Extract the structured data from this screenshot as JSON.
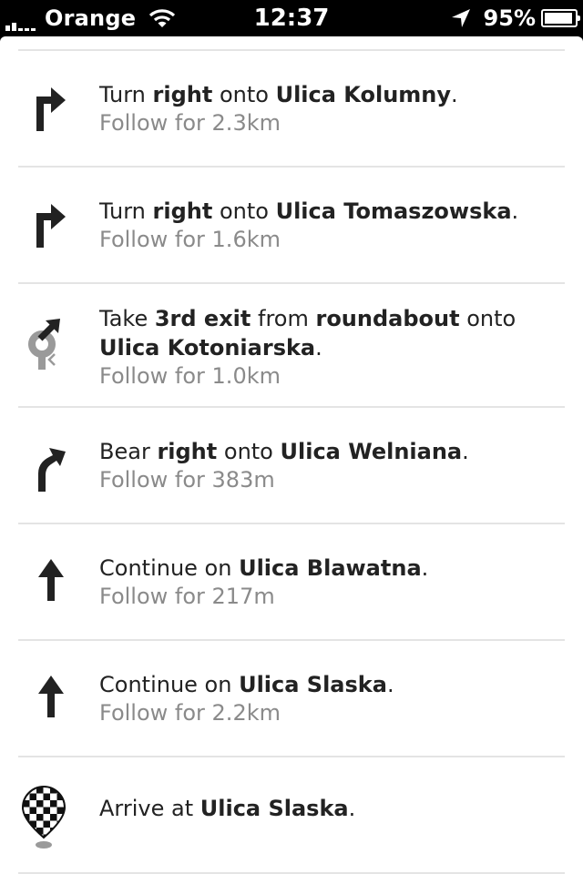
{
  "status_bar": {
    "carrier": "Orange",
    "time": "12:37",
    "battery_percent_text": "95%",
    "battery_level": 0.95,
    "icons": [
      "signal-bars",
      "wifi-icon",
      "location-arrow-icon",
      "battery-icon"
    ]
  },
  "steps": [
    {
      "icon": "turn-right-icon",
      "parts": [
        {
          "text": "Turn ",
          "bold": false
        },
        {
          "text": "right",
          "bold": true
        },
        {
          "text": " onto ",
          "bold": false
        },
        {
          "text": "Ulica Kolumny",
          "bold": true
        },
        {
          "text": ".",
          "bold": false
        }
      ],
      "follow": "Follow for 2.3km"
    },
    {
      "icon": "turn-right-icon",
      "parts": [
        {
          "text": "Turn ",
          "bold": false
        },
        {
          "text": "right",
          "bold": true
        },
        {
          "text": " onto ",
          "bold": false
        },
        {
          "text": "Ulica Tomaszowska",
          "bold": true
        },
        {
          "text": ".",
          "bold": false
        }
      ],
      "follow": "Follow for 1.6km"
    },
    {
      "icon": "roundabout-icon",
      "parts": [
        {
          "text": "Take ",
          "bold": false
        },
        {
          "text": "3rd exit",
          "bold": true
        },
        {
          "text": " from ",
          "bold": false
        },
        {
          "text": "roundabout",
          "bold": true
        },
        {
          "text": " onto",
          "bold": false
        }
      ],
      "parts2": [
        {
          "text": "Ulica Kotoniarska",
          "bold": true
        },
        {
          "text": ".",
          "bold": false
        }
      ],
      "follow": "Follow for 1.0km"
    },
    {
      "icon": "bear-right-icon",
      "parts": [
        {
          "text": "Bear ",
          "bold": false
        },
        {
          "text": "right",
          "bold": true
        },
        {
          "text": " onto ",
          "bold": false
        },
        {
          "text": "Ulica Welniana",
          "bold": true
        },
        {
          "text": ".",
          "bold": false
        }
      ],
      "follow": "Follow for 383m"
    },
    {
      "icon": "straight-arrow-icon",
      "parts": [
        {
          "text": "Continue on ",
          "bold": false
        },
        {
          "text": "Ulica Blawatna",
          "bold": true
        },
        {
          "text": ".",
          "bold": false
        }
      ],
      "follow": "Follow for 217m"
    },
    {
      "icon": "straight-arrow-icon",
      "parts": [
        {
          "text": "Continue on ",
          "bold": false
        },
        {
          "text": "Ulica Slaska",
          "bold": true
        },
        {
          "text": ".",
          "bold": false
        }
      ],
      "follow": "Follow for 2.2km"
    },
    {
      "icon": "checkered-flag-pin-icon",
      "parts": [
        {
          "text": "Arrive at ",
          "bold": false
        },
        {
          "text": "Ulica Slaska",
          "bold": true
        },
        {
          "text": ".",
          "bold": false
        }
      ],
      "follow": ""
    }
  ]
}
